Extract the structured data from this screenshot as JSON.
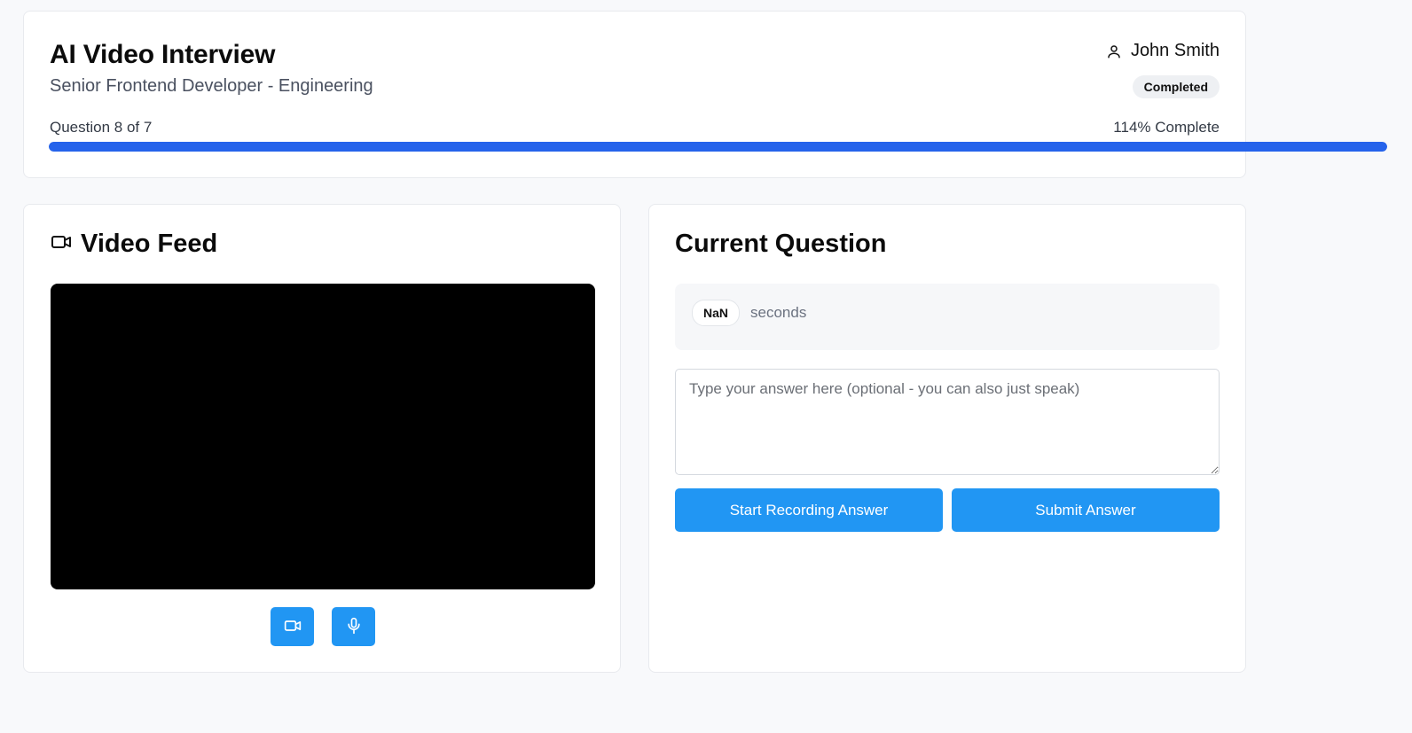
{
  "header": {
    "title": "AI Video Interview",
    "subtitle": "Senior Frontend Developer - Engineering",
    "user_name": "John Smith",
    "status": "Completed",
    "question_progress": "Question 8 of 7",
    "percent_label": "114% Complete",
    "progress_percent": 114
  },
  "video": {
    "title": "Video Feed",
    "camera_icon": "video-camera-icon",
    "mic_icon": "microphone-icon"
  },
  "question": {
    "title": "Current Question",
    "timer_value": "NaN",
    "timer_unit": "seconds",
    "answer_placeholder": "Type your answer here (optional - you can also just speak)",
    "answer_value": "",
    "start_recording_label": "Start Recording Answer",
    "submit_label": "Submit Answer"
  },
  "colors": {
    "accent": "#2196f3",
    "progress": "#2563eb",
    "background": "#f8f9fb"
  }
}
